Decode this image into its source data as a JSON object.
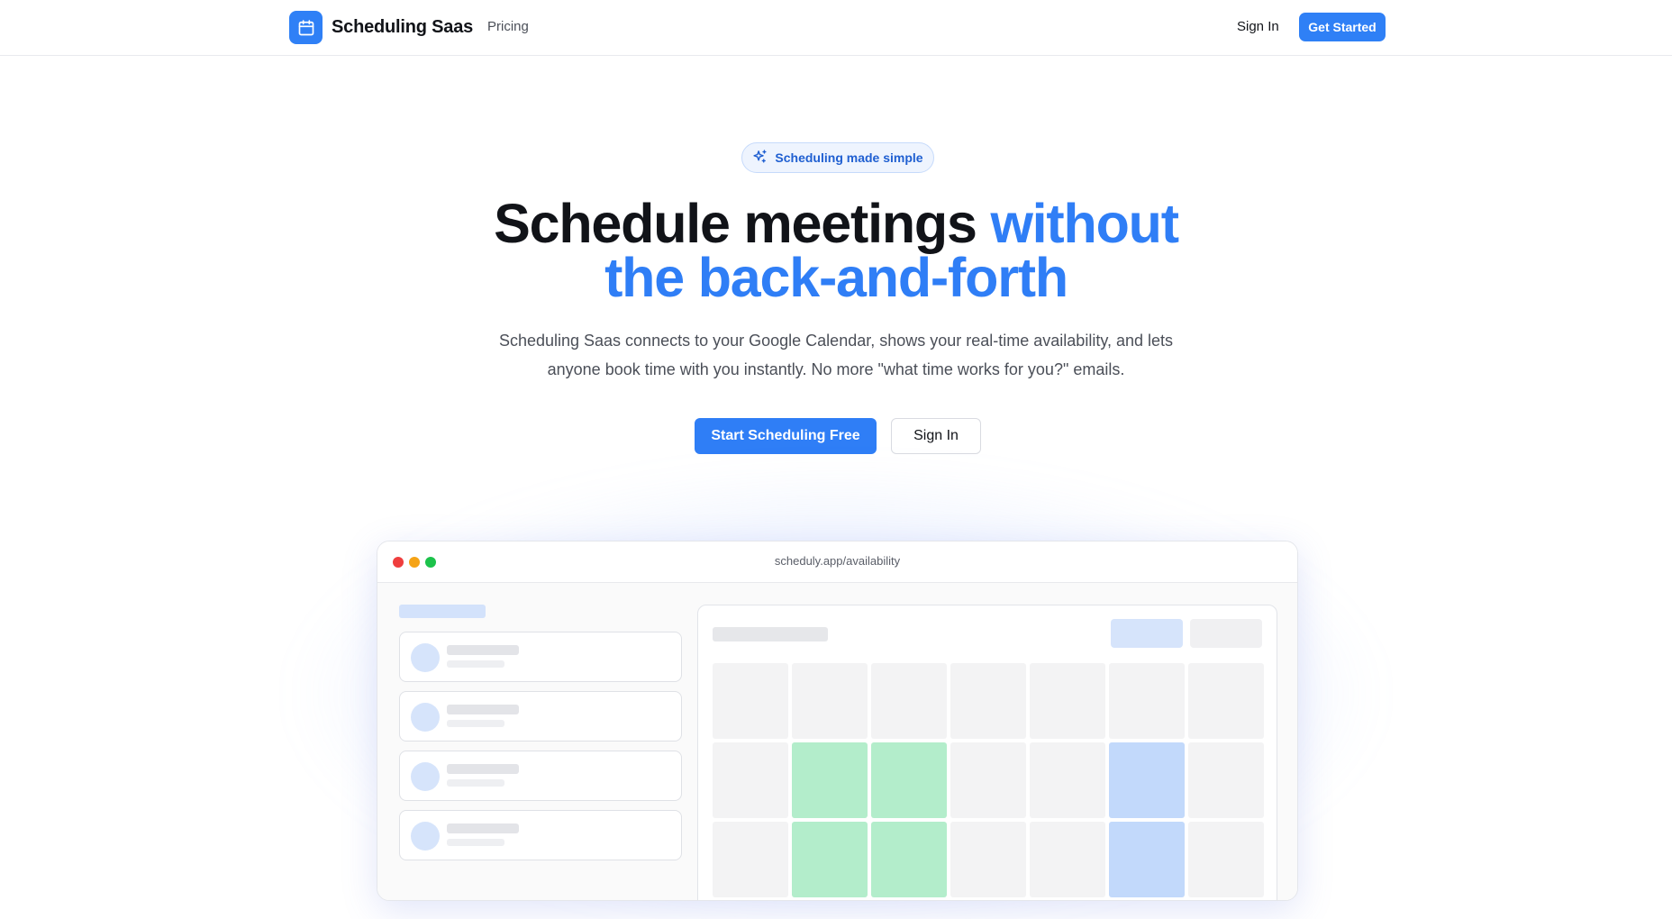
{
  "nav": {
    "brand_name": "Scheduling Saas",
    "links": [
      "Pricing"
    ],
    "signin_label": "Sign In",
    "cta_label": "Get Started",
    "accent_color": "#2f80f6"
  },
  "hero": {
    "badge_text": "Scheduling made simple",
    "title_main": "Schedule meetings ",
    "title_accent_1": "without",
    "title_accent_2": "the back-and-forth",
    "subtitle_line1": "Scheduling Saas connects to your Google Calendar, shows your real-time availability, and lets",
    "subtitle_line2": "anyone book time with you instantly. No more \"what time works for you?\" emails.",
    "primary_button": "Start Scheduling Free",
    "secondary_button": "Sign In"
  },
  "mockup": {
    "url": "scheduly.app/availability",
    "calendar_rows": [
      [
        "empty",
        "empty",
        "empty",
        "empty",
        "empty",
        "empty",
        "empty"
      ],
      [
        "empty",
        "green",
        "green",
        "empty",
        "empty",
        "blue",
        "empty"
      ],
      [
        "empty",
        "green",
        "green",
        "empty",
        "empty",
        "blue",
        "empty"
      ]
    ],
    "colors": {
      "available": "#b3edcb",
      "booked": "#c2d9fb"
    }
  }
}
